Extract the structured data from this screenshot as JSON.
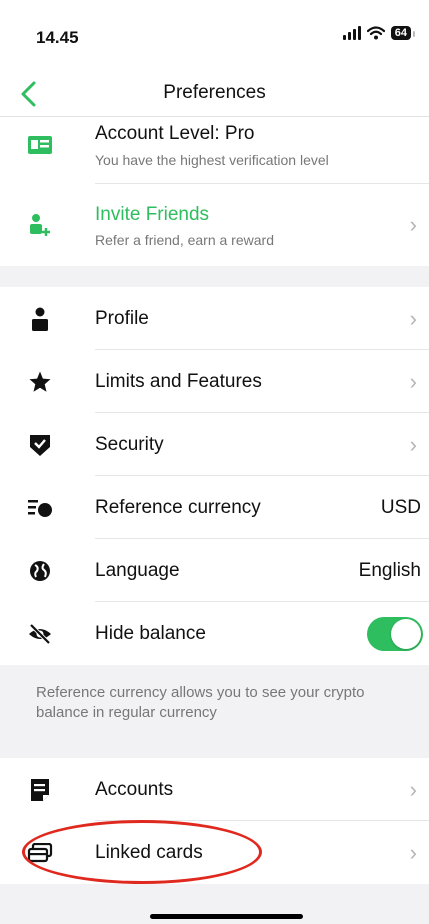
{
  "status": {
    "time": "14.45",
    "battery": "64"
  },
  "nav": {
    "title": "Preferences"
  },
  "account": {
    "title": "Account Level: Pro",
    "subtitle": "You have the highest verification level"
  },
  "invite": {
    "title": "Invite Friends",
    "subtitle": "Refer a friend, earn a reward"
  },
  "settings": {
    "profile": "Profile",
    "limits": "Limits and Features",
    "security": "Security",
    "currency": {
      "label": "Reference currency",
      "value": "USD"
    },
    "language": {
      "label": "Language",
      "value": "English"
    },
    "hide_balance": {
      "label": "Hide balance",
      "on": true
    }
  },
  "note": "Reference currency allows you to see your crypto balance in regular currency",
  "more": {
    "accounts": "Accounts",
    "linked_cards": "Linked cards"
  },
  "colors": {
    "accent": "#2ebd5f",
    "annotation": "#e0291e"
  }
}
